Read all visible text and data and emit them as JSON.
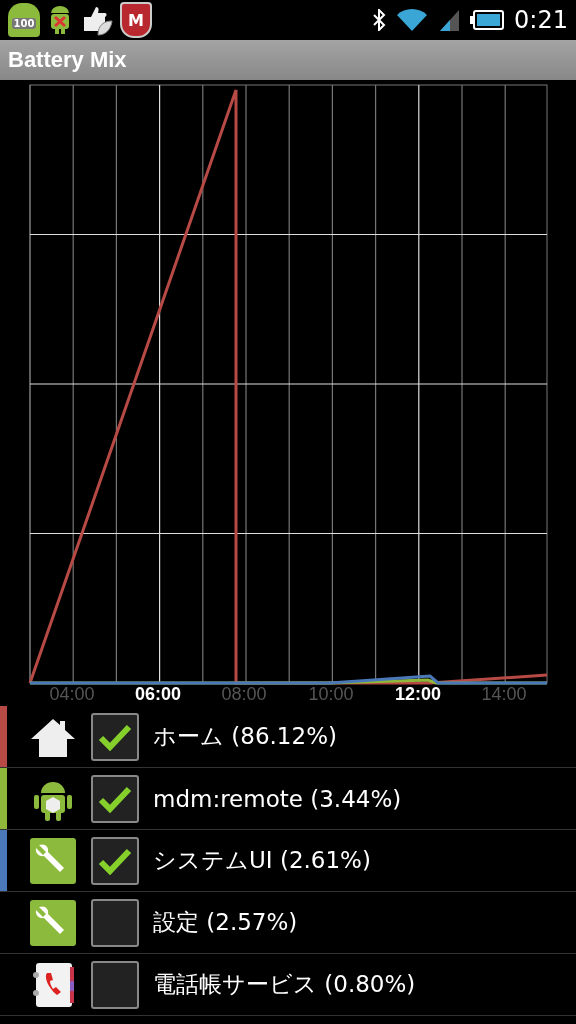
{
  "status_bar": {
    "badge": "100",
    "shield_letter": "M",
    "time": "0:21"
  },
  "app_bar": {
    "title": "Battery Mix"
  },
  "chart": {
    "x_labels": [
      {
        "label": "04:00",
        "major": false
      },
      {
        "label": "06:00",
        "major": true
      },
      {
        "label": "08:00",
        "major": false
      },
      {
        "label": "10:00",
        "major": false
      },
      {
        "label": "12:00",
        "major": true
      },
      {
        "label": "14:00",
        "major": false
      }
    ]
  },
  "items": [
    {
      "kind": "home",
      "label": "ホーム (86.12%)",
      "checked": true,
      "color": "#b84a45"
    },
    {
      "kind": "android",
      "label": "mdm:remote (3.44%)",
      "checked": true,
      "color": "#8fb83a"
    },
    {
      "kind": "wrench",
      "label": "システムUI (2.61%)",
      "checked": true,
      "color": "#4a78b8"
    },
    {
      "kind": "wrench",
      "label": "設定 (2.57%)",
      "checked": false
    },
    {
      "kind": "contacts",
      "label": "電話帳サービス (0.80%)",
      "checked": false
    }
  ]
}
